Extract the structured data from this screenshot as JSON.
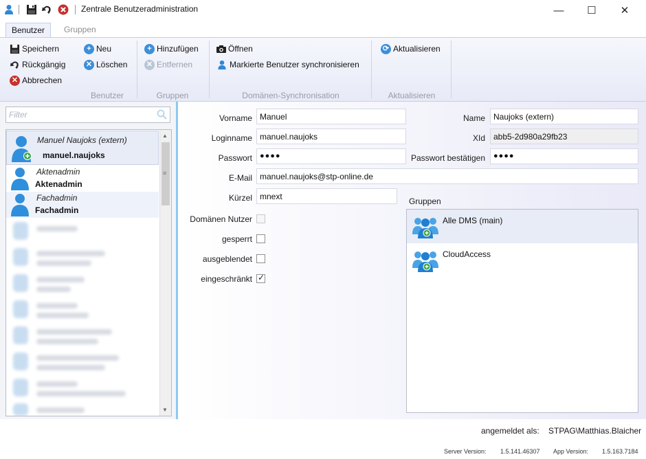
{
  "window": {
    "title": "Zentrale Benutzeradministration",
    "minimize": "—",
    "maximize": "☐",
    "close": "✕"
  },
  "ribbon": {
    "tabs": [
      "Benutzer",
      "Gruppen"
    ],
    "actions": {
      "save": "Speichern",
      "undo": "Rückgängig",
      "cancel": "Abbrechen",
      "new": "Neu",
      "delete": "Löschen",
      "add": "Hinzufügen",
      "remove": "Entfernen",
      "open": "Öffnen",
      "sync": "Markierte Benutzer synchronisieren",
      "refresh": "Aktualisieren"
    },
    "groups": {
      "benutzer": "Benutzer",
      "gruppen": "Gruppen",
      "domain_sync": "Domänen-Synchronisation",
      "aktualisieren": "Aktualisieren"
    }
  },
  "left": {
    "filter_placeholder": "Filter",
    "users": [
      {
        "display": "Manuel Naujoks (extern)",
        "login": "manuel.naujoks"
      },
      {
        "display": "Aktenadmin",
        "login": "Aktenadmin"
      },
      {
        "display": "Fachadmin",
        "login": "Fachadmin"
      }
    ]
  },
  "form": {
    "labels": {
      "vorname": "Vorname",
      "name": "Name",
      "loginname": "Loginname",
      "xid": "XId",
      "passwort": "Passwort",
      "passwort_bestaetigen": "Passwort bestätigen",
      "email": "E-Mail",
      "kuerzel": "Kürzel",
      "domaenen_nutzer": "Domänen Nutzer",
      "gesperrt": "gesperrt",
      "ausgeblendet": "ausgeblendet",
      "eingeschraenkt": "eingeschränkt",
      "gruppen": "Gruppen"
    },
    "values": {
      "vorname": "Manuel",
      "name": "Naujoks (extern)",
      "loginname": "manuel.naujoks",
      "xid": "abb5-2d980a29fb23",
      "passwort": "●●●●",
      "passwort_bestaetigen": "●●●●",
      "email": "manuel.naujoks@stp-online.de",
      "kuerzel": "mnext"
    },
    "checkboxes": {
      "domaenen_nutzer": false,
      "gesperrt": false,
      "ausgeblendet": false,
      "eingeschraenkt": true
    },
    "groups": [
      "Alle DMS (main)",
      "CloudAccess"
    ]
  },
  "footer": {
    "logged_in_label": "angemeldet als:",
    "logged_in_user": "STPAG\\Matthias.Blaicher",
    "server_version_label": "Server Version:",
    "server_version": "1.5.141.46307",
    "app_version_label": "App Version:",
    "app_version": "1.5.163.7184"
  }
}
